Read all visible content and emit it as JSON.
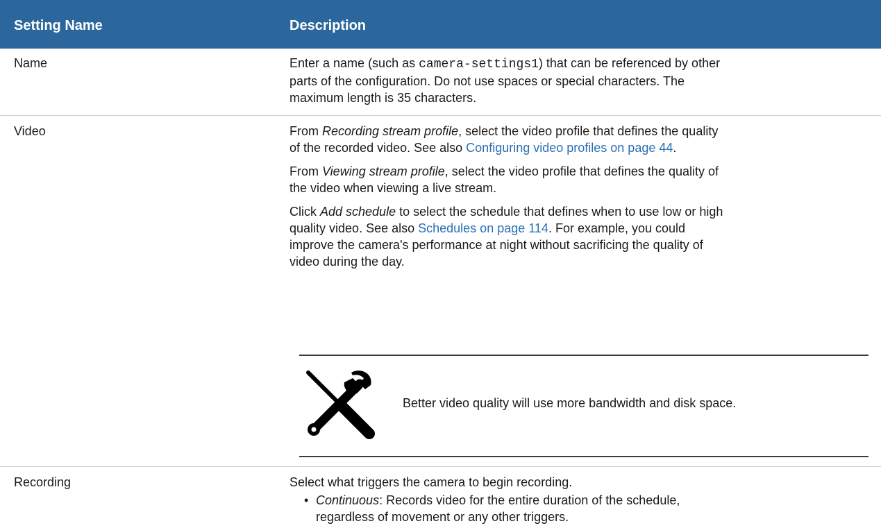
{
  "header": {
    "col1": "Setting Name",
    "col2": "Description"
  },
  "rows": {
    "name": {
      "label": "Name",
      "desc_pre": "Enter a name (such as ",
      "desc_code": "camera-settings1",
      "desc_post1": ") that can be referenced by other",
      "desc_line2": "parts of the configuration. Do not use spaces or special characters. The",
      "desc_line3": "maximum length is 35 characters."
    },
    "video": {
      "label": "Video",
      "p1_pre": "From ",
      "p1_em": "Recording stream profile",
      "p1_post": ", select the video profile that defines the quality",
      "p1_line2": "of the recorded video. See also ",
      "p1_link": "Configuring video profiles on page 44",
      "p1_end": ".",
      "p2_pre": "From ",
      "p2_em": "Viewing stream profile",
      "p2_post": ", select the video profile that defines the quality of",
      "p2_line2": "the video when viewing a live stream.",
      "p3_pre": "Click ",
      "p3_em": "Add schedule",
      "p3_post": " to select the schedule that defines when to use low or high",
      "p3_line2_pre": "quality video. See also ",
      "p3_link": "Schedules on page 114",
      "p3_line2_post": ". For example, you could",
      "p3_line3": "improve the camera's performance at night without sacrificing the quality of",
      "p3_line4": "video during the day.",
      "note": "Better video quality will use more bandwidth and disk space.",
      "note_icon": "tools-icon"
    },
    "recording": {
      "label": "Recording",
      "desc": "Select what triggers the camera to begin recording.",
      "bullet": "•",
      "b1_em": "Continuous",
      "b1_post": ": Records video for the entire duration of the schedule,",
      "b1_line2": "regardless of movement or any other triggers."
    }
  },
  "colors": {
    "header_bg": "#2b679c",
    "link": "#2a6fb5"
  }
}
